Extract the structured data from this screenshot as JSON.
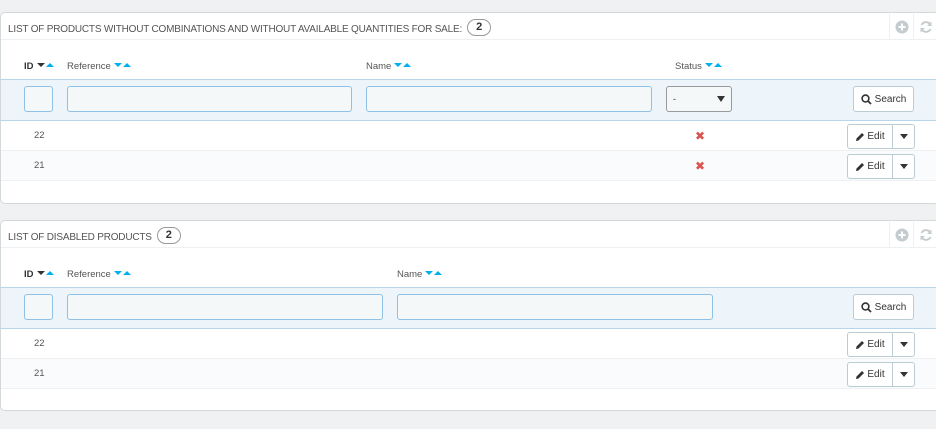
{
  "panels": [
    {
      "title": "LIST OF PRODUCTS WITHOUT COMBINATIONS AND WITHOUT AVAILABLE QUANTITIES FOR SALE:",
      "count": "2",
      "columns": {
        "id": "ID",
        "reference": "Reference",
        "name": "Name",
        "status": "Status"
      },
      "filter": {
        "status_value": "-",
        "search_label": "Search"
      },
      "rows": [
        {
          "id": "22",
          "status_icon": "✖",
          "edit_label": "Edit"
        },
        {
          "id": "21",
          "status_icon": "✖",
          "edit_label": "Edit"
        }
      ]
    },
    {
      "title": "LIST OF DISABLED PRODUCTS",
      "count": "2",
      "columns": {
        "id": "ID",
        "reference": "Reference",
        "name": "Name"
      },
      "filter": {
        "search_label": "Search"
      },
      "rows": [
        {
          "id": "22",
          "edit_label": "Edit"
        },
        {
          "id": "21",
          "edit_label": "Edit"
        }
      ]
    }
  ],
  "colors": {
    "accent": "#00aff0",
    "status_disabled": "#d9534f",
    "filter_bg": "#edf5fb"
  },
  "icons": {
    "add": "plus-circle-icon",
    "refresh": "refresh-icon",
    "search": "search-icon",
    "edit": "pencil-icon",
    "status": "times-icon"
  }
}
